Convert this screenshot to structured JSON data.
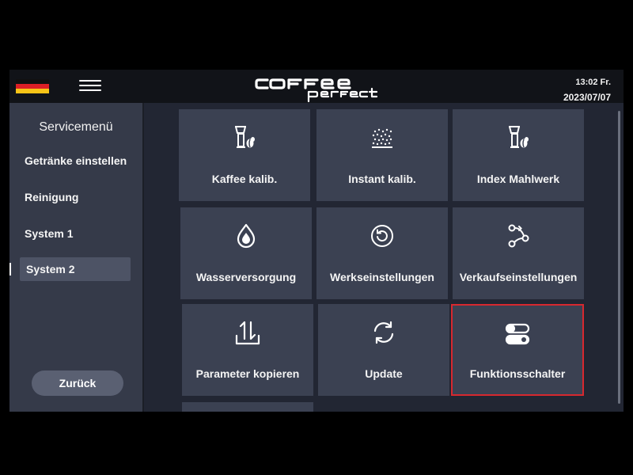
{
  "header": {
    "time": "13:02 Fr.",
    "date": "2023/07/07",
    "flag_colors": [
      "#111111",
      "#dd1f26",
      "#f7c417"
    ]
  },
  "sidebar": {
    "title": "Servicemenü",
    "items": [
      {
        "label": "Getränke einstellen"
      },
      {
        "label": "Reinigung"
      },
      {
        "label": "System 1"
      },
      {
        "label": "System 2"
      }
    ],
    "back_label": "Zurück"
  },
  "tiles": [
    {
      "label": "Kaffee kalib.",
      "icon": "coffee-grinder-icon"
    },
    {
      "label": "Instant kalib.",
      "icon": "powder-icon"
    },
    {
      "label": "Index Mahlwerk",
      "icon": "coffee-grinder-icon"
    },
    {
      "label": "Wasserversorgung",
      "icon": "water-drop-icon"
    },
    {
      "label": "Werkseinstellungen",
      "icon": "reset-icon"
    },
    {
      "label": "Verkaufseinstellungen",
      "icon": "flow-nodes-icon"
    },
    {
      "label": "Parameter kopieren",
      "icon": "transfer-icon"
    },
    {
      "label": "Update",
      "icon": "sync-icon"
    },
    {
      "label": "Funktionsschalter",
      "icon": "toggle-switches-icon"
    }
  ],
  "accent_colors": {
    "selected_border": "#d7282f"
  }
}
